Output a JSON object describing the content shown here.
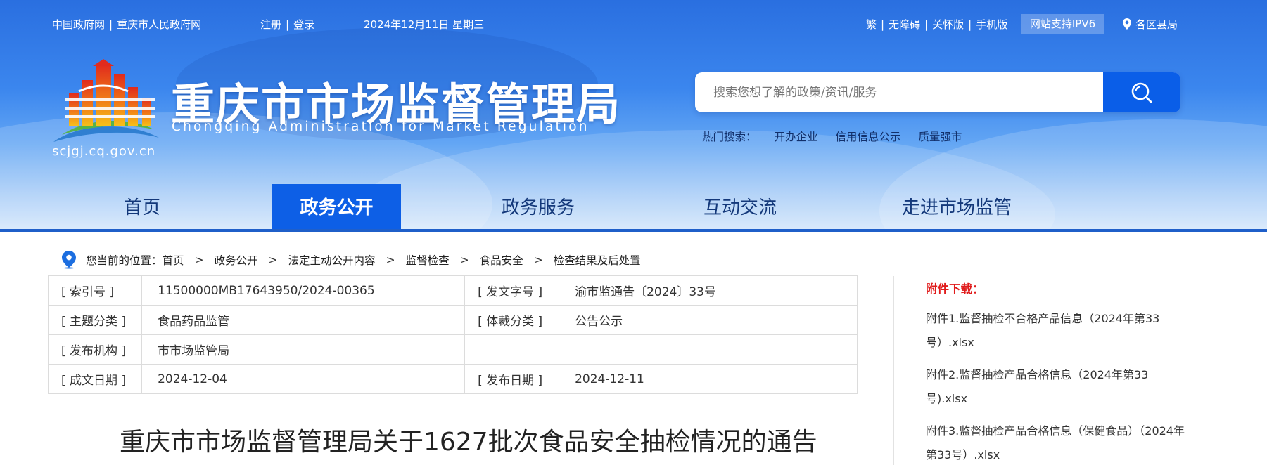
{
  "topbar": {
    "gov_link": "中国政府网",
    "cq_link": "重庆市人民政府网",
    "register": "注册",
    "login": "登录",
    "date": "2024年12月11日 星期三",
    "traditional": "繁",
    "accessible": "无障碍",
    "care": "关怀版",
    "mobile": "手机版",
    "ipv6": "网站支持IPV6",
    "districts": "各区县局"
  },
  "logo": {
    "title": "重庆市市场监督管理局",
    "english": "Chongqing  Administration for Market Regulation",
    "domain": "scjgj.cq.gov.cn"
  },
  "search": {
    "placeholder": "搜索您想了解的政策/资讯/服务",
    "hot_label": "热门搜索：",
    "hot_items": [
      "开办企业",
      "信用信息公示",
      "质量强市"
    ]
  },
  "nav": {
    "items": [
      "首页",
      "政务公开",
      "政务服务",
      "互动交流",
      "走进市场监管"
    ],
    "active": "政务公开"
  },
  "breadcrumb": {
    "label": "您当前的位置：",
    "items": [
      "首页",
      "政务公开",
      "法定主动公开内容",
      "监督检查",
      "食品安全",
      "检查结果及后处置"
    ]
  },
  "meta": {
    "rows": [
      {
        "k1": "[ 索引号 ]",
        "v1": "11500000MB17643950/2024-00365",
        "k2": "[ 发文字号 ]",
        "v2": "渝市监通告〔2024〕33号"
      },
      {
        "k1": "[ 主题分类 ]",
        "v1": "食品药品监管",
        "k2": "[ 体裁分类 ]",
        "v2": "公告公示"
      },
      {
        "k1": "[ 发布机构 ]",
        "v1": "市市场监管局",
        "k2": "",
        "v2": ""
      },
      {
        "k1": "[ 成文日期 ]",
        "v1": "2024-12-04",
        "k2": "[ 发布日期 ]",
        "v2": "2024-12-11"
      }
    ]
  },
  "article": {
    "title": "重庆市市场监督管理局关于1627批次食品安全抽检情况的通告"
  },
  "sidebar": {
    "heading": "附件下载：",
    "attachments": [
      "附件1.监督抽检不合格产品信息（2024年第33号）.xlsx",
      "附件2.监督抽检产品合格信息（2024年第33号).xlsx",
      "附件3.监督抽检产品合格信息（保健食品）（2024年第33号）.xlsx"
    ]
  },
  "colors": {
    "nav_active": "#0d5fe6",
    "nav_active_underline": "#e02a2a",
    "attachment_heading": "#e01b1b",
    "search_button": "#0a5ee8"
  }
}
